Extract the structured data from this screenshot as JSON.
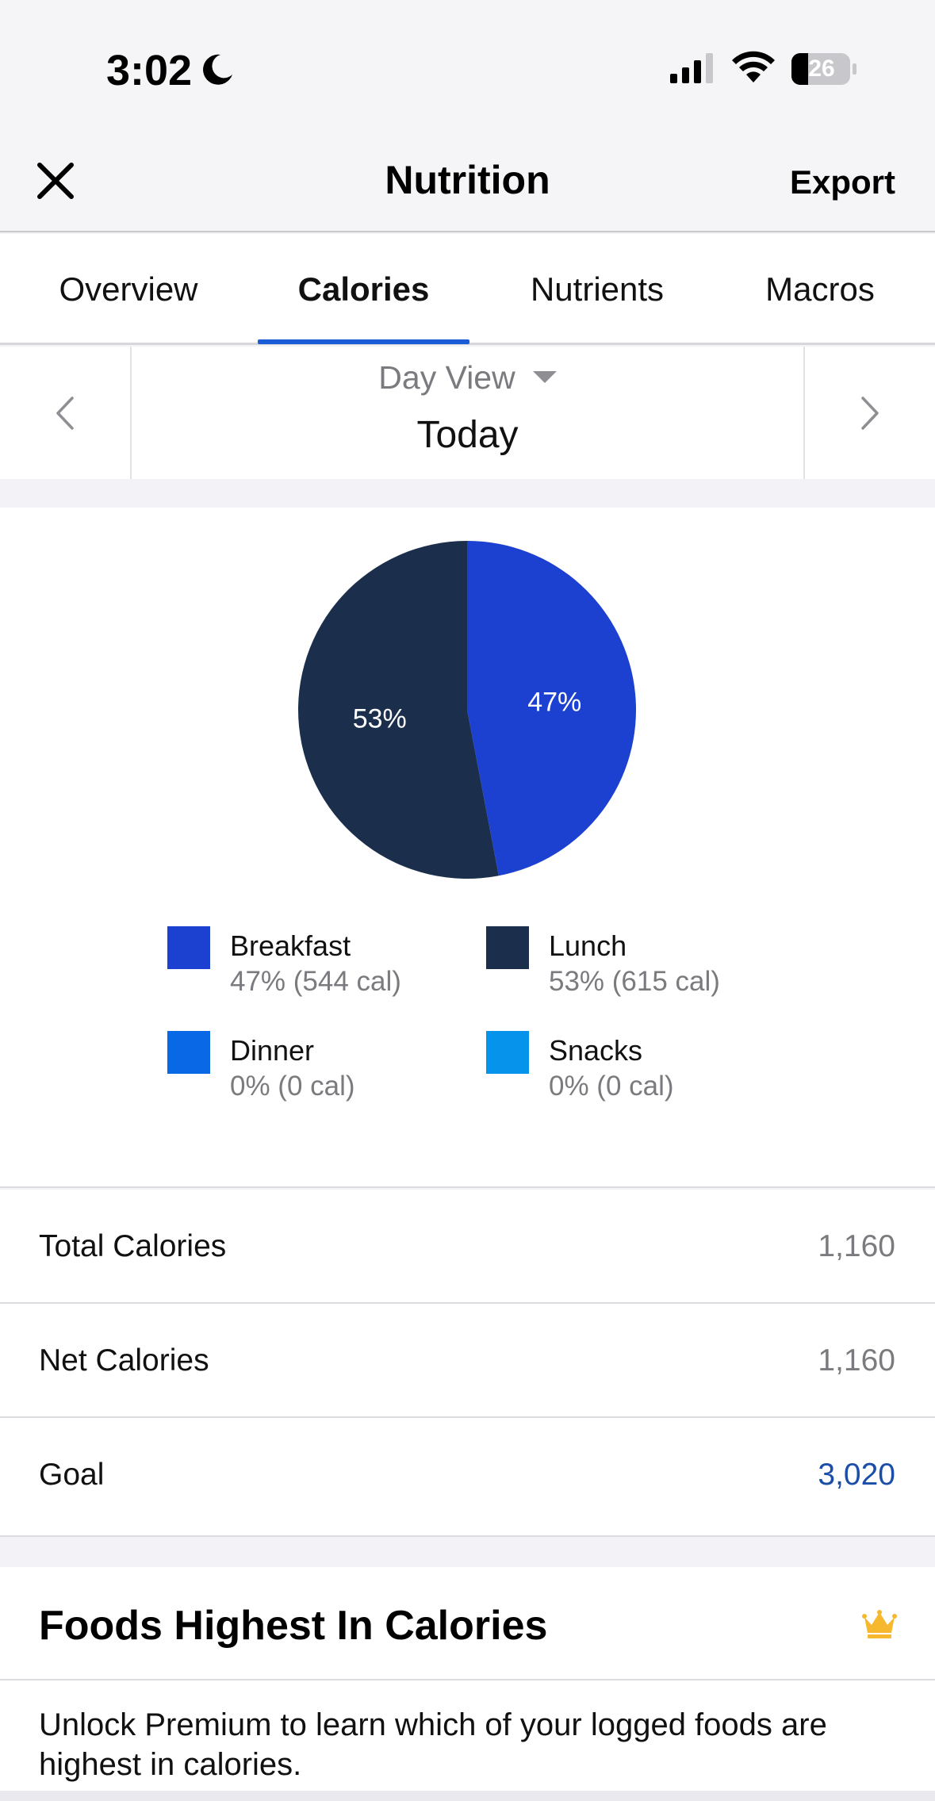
{
  "status_bar": {
    "time": "3:02",
    "battery": "26"
  },
  "nav": {
    "title": "Nutrition",
    "export_label": "Export"
  },
  "tabs": [
    {
      "label": "Overview",
      "active": false
    },
    {
      "label": "Calories",
      "active": true
    },
    {
      "label": "Nutrients",
      "active": false
    },
    {
      "label": "Macros",
      "active": false
    }
  ],
  "date_selector": {
    "view_label": "Day View",
    "date_label": "Today"
  },
  "chart_data": {
    "type": "pie",
    "slices": [
      {
        "name": "Breakfast",
        "percent": 47,
        "label": "47%",
        "color": "#1c40d0"
      },
      {
        "name": "Lunch",
        "percent": 53,
        "label": "53%",
        "color": "#1b2f4d"
      },
      {
        "name": "Dinner",
        "percent": 0,
        "label": "",
        "color": "#0868e6"
      },
      {
        "name": "Snacks",
        "percent": 0,
        "label": "",
        "color": "#0593ec"
      }
    ]
  },
  "legend": [
    {
      "name": "Breakfast",
      "value": "47% (544 cal)",
      "color": "#1c40d0"
    },
    {
      "name": "Lunch",
      "value": "53% (615 cal)",
      "color": "#1b2f4d"
    },
    {
      "name": "Dinner",
      "value": "0% (0 cal)",
      "color": "#0868e6"
    },
    {
      "name": "Snacks",
      "value": "0% (0 cal)",
      "color": "#0593ec"
    }
  ],
  "stats": [
    {
      "label": "Total Calories",
      "value": "1,160"
    },
    {
      "label": "Net Calories",
      "value": "1,160"
    },
    {
      "label": "Goal",
      "value": "3,020"
    }
  ],
  "premium": {
    "title": "Foods Highest In Calories",
    "text": "Unlock Premium to learn which of your logged foods are highest in calories."
  },
  "colors": {
    "accent": "#1a5bd6",
    "goal": "#1a4ea8",
    "crown": "#f5b82e"
  }
}
